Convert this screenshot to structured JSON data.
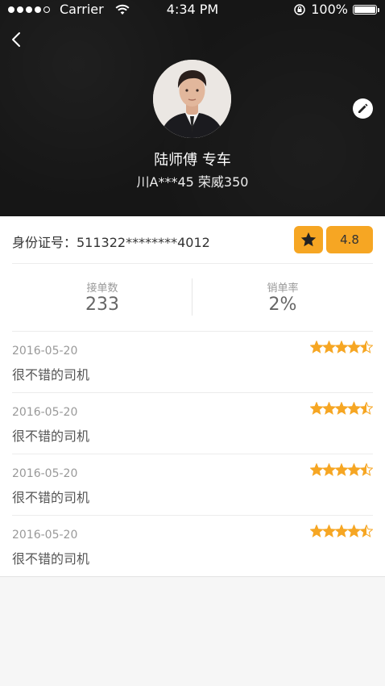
{
  "status_bar": {
    "carrier": "Carrier",
    "time": "4:34 PM",
    "battery": "100%",
    "signal_bars": 4
  },
  "profile": {
    "driver_name": "陆师傅 专车",
    "plate": "川A***45 荣威350"
  },
  "id_card": {
    "text": "身份证号：511322********4012",
    "rating": "4.8"
  },
  "stats": {
    "orders_label": "接单数",
    "orders_value": "233",
    "cancel_label": "销单率",
    "cancel_value": "2%"
  },
  "reviews": [
    {
      "date": "2016-05-20",
      "comment": "很不错的司机",
      "stars": 4.5
    },
    {
      "date": "2016-05-20",
      "comment": "很不错的司机",
      "stars": 4.5
    },
    {
      "date": "2016-05-20",
      "comment": "很不错的司机",
      "stars": 4.5
    },
    {
      "date": "2016-05-20",
      "comment": "很不错的司机",
      "stars": 4.5
    }
  ],
  "colors": {
    "accent": "#f6a623",
    "header_bg": "#161616"
  },
  "icons": {
    "back": "chevron-left-icon",
    "edit": "pencil-icon",
    "rating_star": "star-icon",
    "wifi": "wifi-icon",
    "lock": "rotation-lock-icon"
  }
}
